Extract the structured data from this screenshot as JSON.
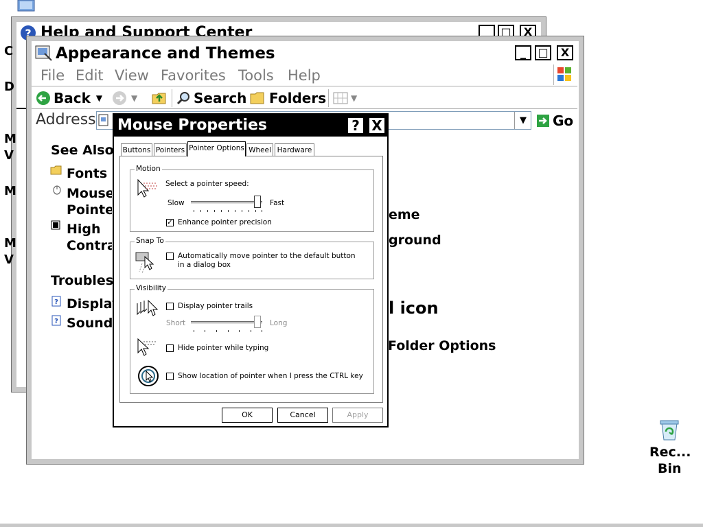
{
  "help_window": {
    "title": "Help and Support Center",
    "side_letters": [
      "C",
      "D",
      "M",
      "V",
      "M",
      "M",
      "V"
    ]
  },
  "main_window": {
    "title": "Appearance and Themes",
    "menu": [
      "File",
      "Edit",
      "View",
      "Favorites",
      "Tools",
      "Help"
    ],
    "toolbar": {
      "back": "Back",
      "search": "Search",
      "folders": "Folders"
    },
    "address_label": "Address",
    "go_label": "Go",
    "see_also": {
      "heading": "See Also",
      "items": [
        "Fonts",
        "Mouse Pointers",
        "High Contrast"
      ]
    },
    "troubleshooters": {
      "heading": "Troublesh",
      "items": [
        "Display",
        "Sound"
      ]
    },
    "right_fragments": {
      "theme": "eme",
      "background": "ground",
      "panel_icon": "l icon",
      "folder_options": "Folder Options"
    }
  },
  "dialog": {
    "title": "Mouse Properties",
    "help_btn": "?",
    "close_btn": "X",
    "tabs": [
      "Buttons",
      "Pointers",
      "Pointer Options",
      "Wheel",
      "Hardware"
    ],
    "active_tab": "Pointer Options",
    "motion": {
      "label": "Motion",
      "speed_label": "Select a pointer speed:",
      "slow": "Slow",
      "fast": "Fast",
      "speed_value": 0.97,
      "precision_label": "Enhance pointer precision",
      "precision_checked": true
    },
    "snap_to": {
      "label": "Snap To",
      "text": "Automatically move pointer to the default button in a dialog box",
      "checked": false
    },
    "visibility": {
      "label": "Visibility",
      "trails_label": "Display pointer trails",
      "trails_checked": false,
      "short": "Short",
      "long": "Long",
      "trails_value": 0.97,
      "hide_label": "Hide pointer while typing",
      "hide_checked": false,
      "ctrl_label": "Show location of pointer when I press the CTRL key",
      "ctrl_checked": false
    },
    "buttons": {
      "ok": "OK",
      "cancel": "Cancel",
      "apply": "Apply"
    }
  },
  "desktop": {
    "recycle_bin_line1": "Rec...",
    "recycle_bin_line2": "Bin"
  }
}
